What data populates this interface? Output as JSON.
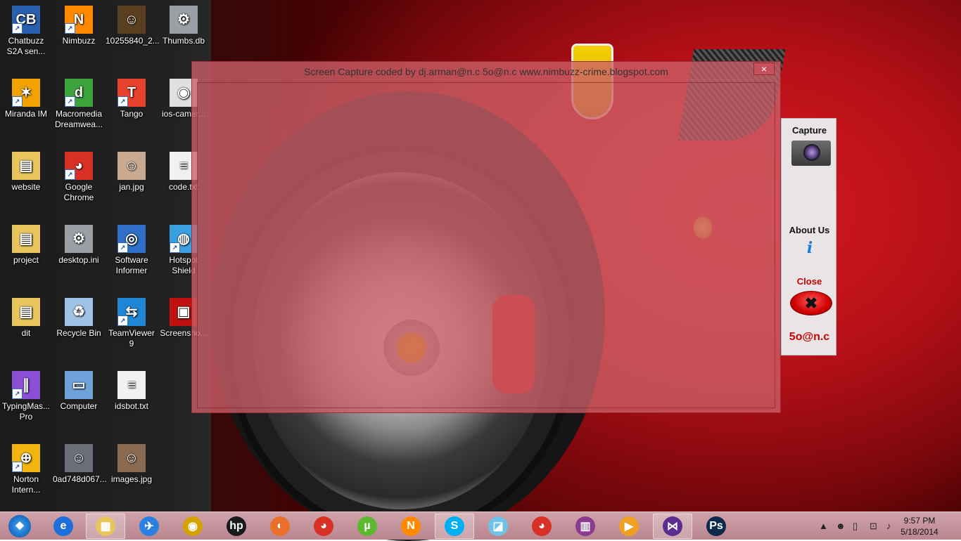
{
  "desktop": {
    "icons": [
      {
        "label": "Chatbuzz S2A sen...",
        "glyph": "CB",
        "color": "#2a5fb0"
      },
      {
        "label": "Nimbuzz",
        "glyph": "N",
        "color": "#ff8a00"
      },
      {
        "label": "10255840_2...",
        "glyph": "☺",
        "color": "#5a4020"
      },
      {
        "label": "Thumbs.db",
        "glyph": "⚙",
        "color": "#9aa0a6"
      },
      {
        "label": "Miranda IM",
        "glyph": "✶",
        "color": "#f2a200"
      },
      {
        "label": "Macromedia Dreamwea...",
        "glyph": "d",
        "color": "#3da33d"
      },
      {
        "label": "Tango",
        "glyph": "T",
        "color": "#e8412c"
      },
      {
        "label": "ios-camer...",
        "glyph": "◉",
        "color": "#e0e0e0"
      },
      {
        "label": "website",
        "glyph": "▤",
        "color": "#e8c55c"
      },
      {
        "label": "Google Chrome",
        "glyph": "◕",
        "color": "#d93025"
      },
      {
        "label": "jan.jpg",
        "glyph": "☺",
        "color": "#c9a98f"
      },
      {
        "label": "code.txt",
        "glyph": "≡",
        "color": "#f1f1f1"
      },
      {
        "label": "project",
        "glyph": "▤",
        "color": "#e8c55c"
      },
      {
        "label": "desktop.ini",
        "glyph": "⚙",
        "color": "#9aa0a6"
      },
      {
        "label": "Software Informer",
        "glyph": "◎",
        "color": "#2f6fc9"
      },
      {
        "label": "Hotspot Shield",
        "glyph": "◍",
        "color": "#3aa0e0"
      },
      {
        "label": "dit",
        "glyph": "▤",
        "color": "#e8c55c"
      },
      {
        "label": "Recycle Bin",
        "glyph": "♻",
        "color": "#9fc3e6"
      },
      {
        "label": "TeamViewer 9",
        "glyph": "⇆",
        "color": "#1f86d6"
      },
      {
        "label": "Screensho...",
        "glyph": "▣",
        "color": "#c01010"
      },
      {
        "label": "TypingMas... Pro",
        "glyph": "∥",
        "color": "#8b4fd6"
      },
      {
        "label": "Computer",
        "glyph": "▭",
        "color": "#6fa2d9"
      },
      {
        "label": "idsbot.txt",
        "glyph": "≡",
        "color": "#f1f1f1"
      },
      {
        "label": "Norton Intern...",
        "glyph": "⊕",
        "color": "#f2b50f"
      },
      {
        "label": "0ad748d067...",
        "glyph": "☺",
        "color": "#6b6f7a"
      },
      {
        "label": "images.jpg",
        "glyph": "☺",
        "color": "#8a6a50"
      }
    ]
  },
  "capture_window": {
    "title": "Screen Capture coded by dj.arman@n.c  5o@n.c www.nimbuzz-crime.blogspot.com",
    "close_glyph": "×"
  },
  "side_panel": {
    "capture_label": "Capture",
    "about_label": "About Us",
    "about_glyph": "i",
    "close_label": "Close",
    "close_glyph": "✖",
    "signature": "5o@n.c",
    "signature_color": "#cc0000",
    "close_label_color": "#cc0000"
  },
  "taskbar": {
    "start_glyph": "❖",
    "items": [
      {
        "name": "internet-explorer",
        "glyph": "e",
        "color": "#1e6fd9"
      },
      {
        "name": "file-explorer",
        "glyph": "▦",
        "color": "#e8c55c"
      },
      {
        "name": "app-rocket",
        "glyph": "✈",
        "color": "#2b7fe0"
      },
      {
        "name": "media-player",
        "glyph": "◉",
        "color": "#d4a300"
      },
      {
        "name": "hp",
        "glyph": "hp",
        "color": "#1a1a1a"
      },
      {
        "name": "firefox",
        "glyph": "◐",
        "color": "#e8702a"
      },
      {
        "name": "chrome",
        "glyph": "◕",
        "color": "#d93025"
      },
      {
        "name": "utorrent",
        "glyph": "µ",
        "color": "#5cb82e"
      },
      {
        "name": "nimbuzz",
        "glyph": "N",
        "color": "#ff8a00"
      },
      {
        "name": "skype",
        "glyph": "S",
        "color": "#00aff0"
      },
      {
        "name": "notes",
        "glyph": "◪",
        "color": "#6fc3e6"
      },
      {
        "name": "chrome-2",
        "glyph": "◕",
        "color": "#d93025"
      },
      {
        "name": "winrar",
        "glyph": "▥",
        "color": "#8b3a8f"
      },
      {
        "name": "video-app",
        "glyph": "▶",
        "color": "#f0a020"
      },
      {
        "name": "visual-studio",
        "glyph": "⋈",
        "color": "#5a2d8f"
      },
      {
        "name": "photoshop",
        "glyph": "Ps",
        "color": "#0c2a4a"
      }
    ],
    "clock_time": "9:57 PM",
    "clock_date": "5/18/2014",
    "tray_icons": [
      "▲",
      "☻",
      "▯",
      "⊡",
      "♪"
    ]
  }
}
